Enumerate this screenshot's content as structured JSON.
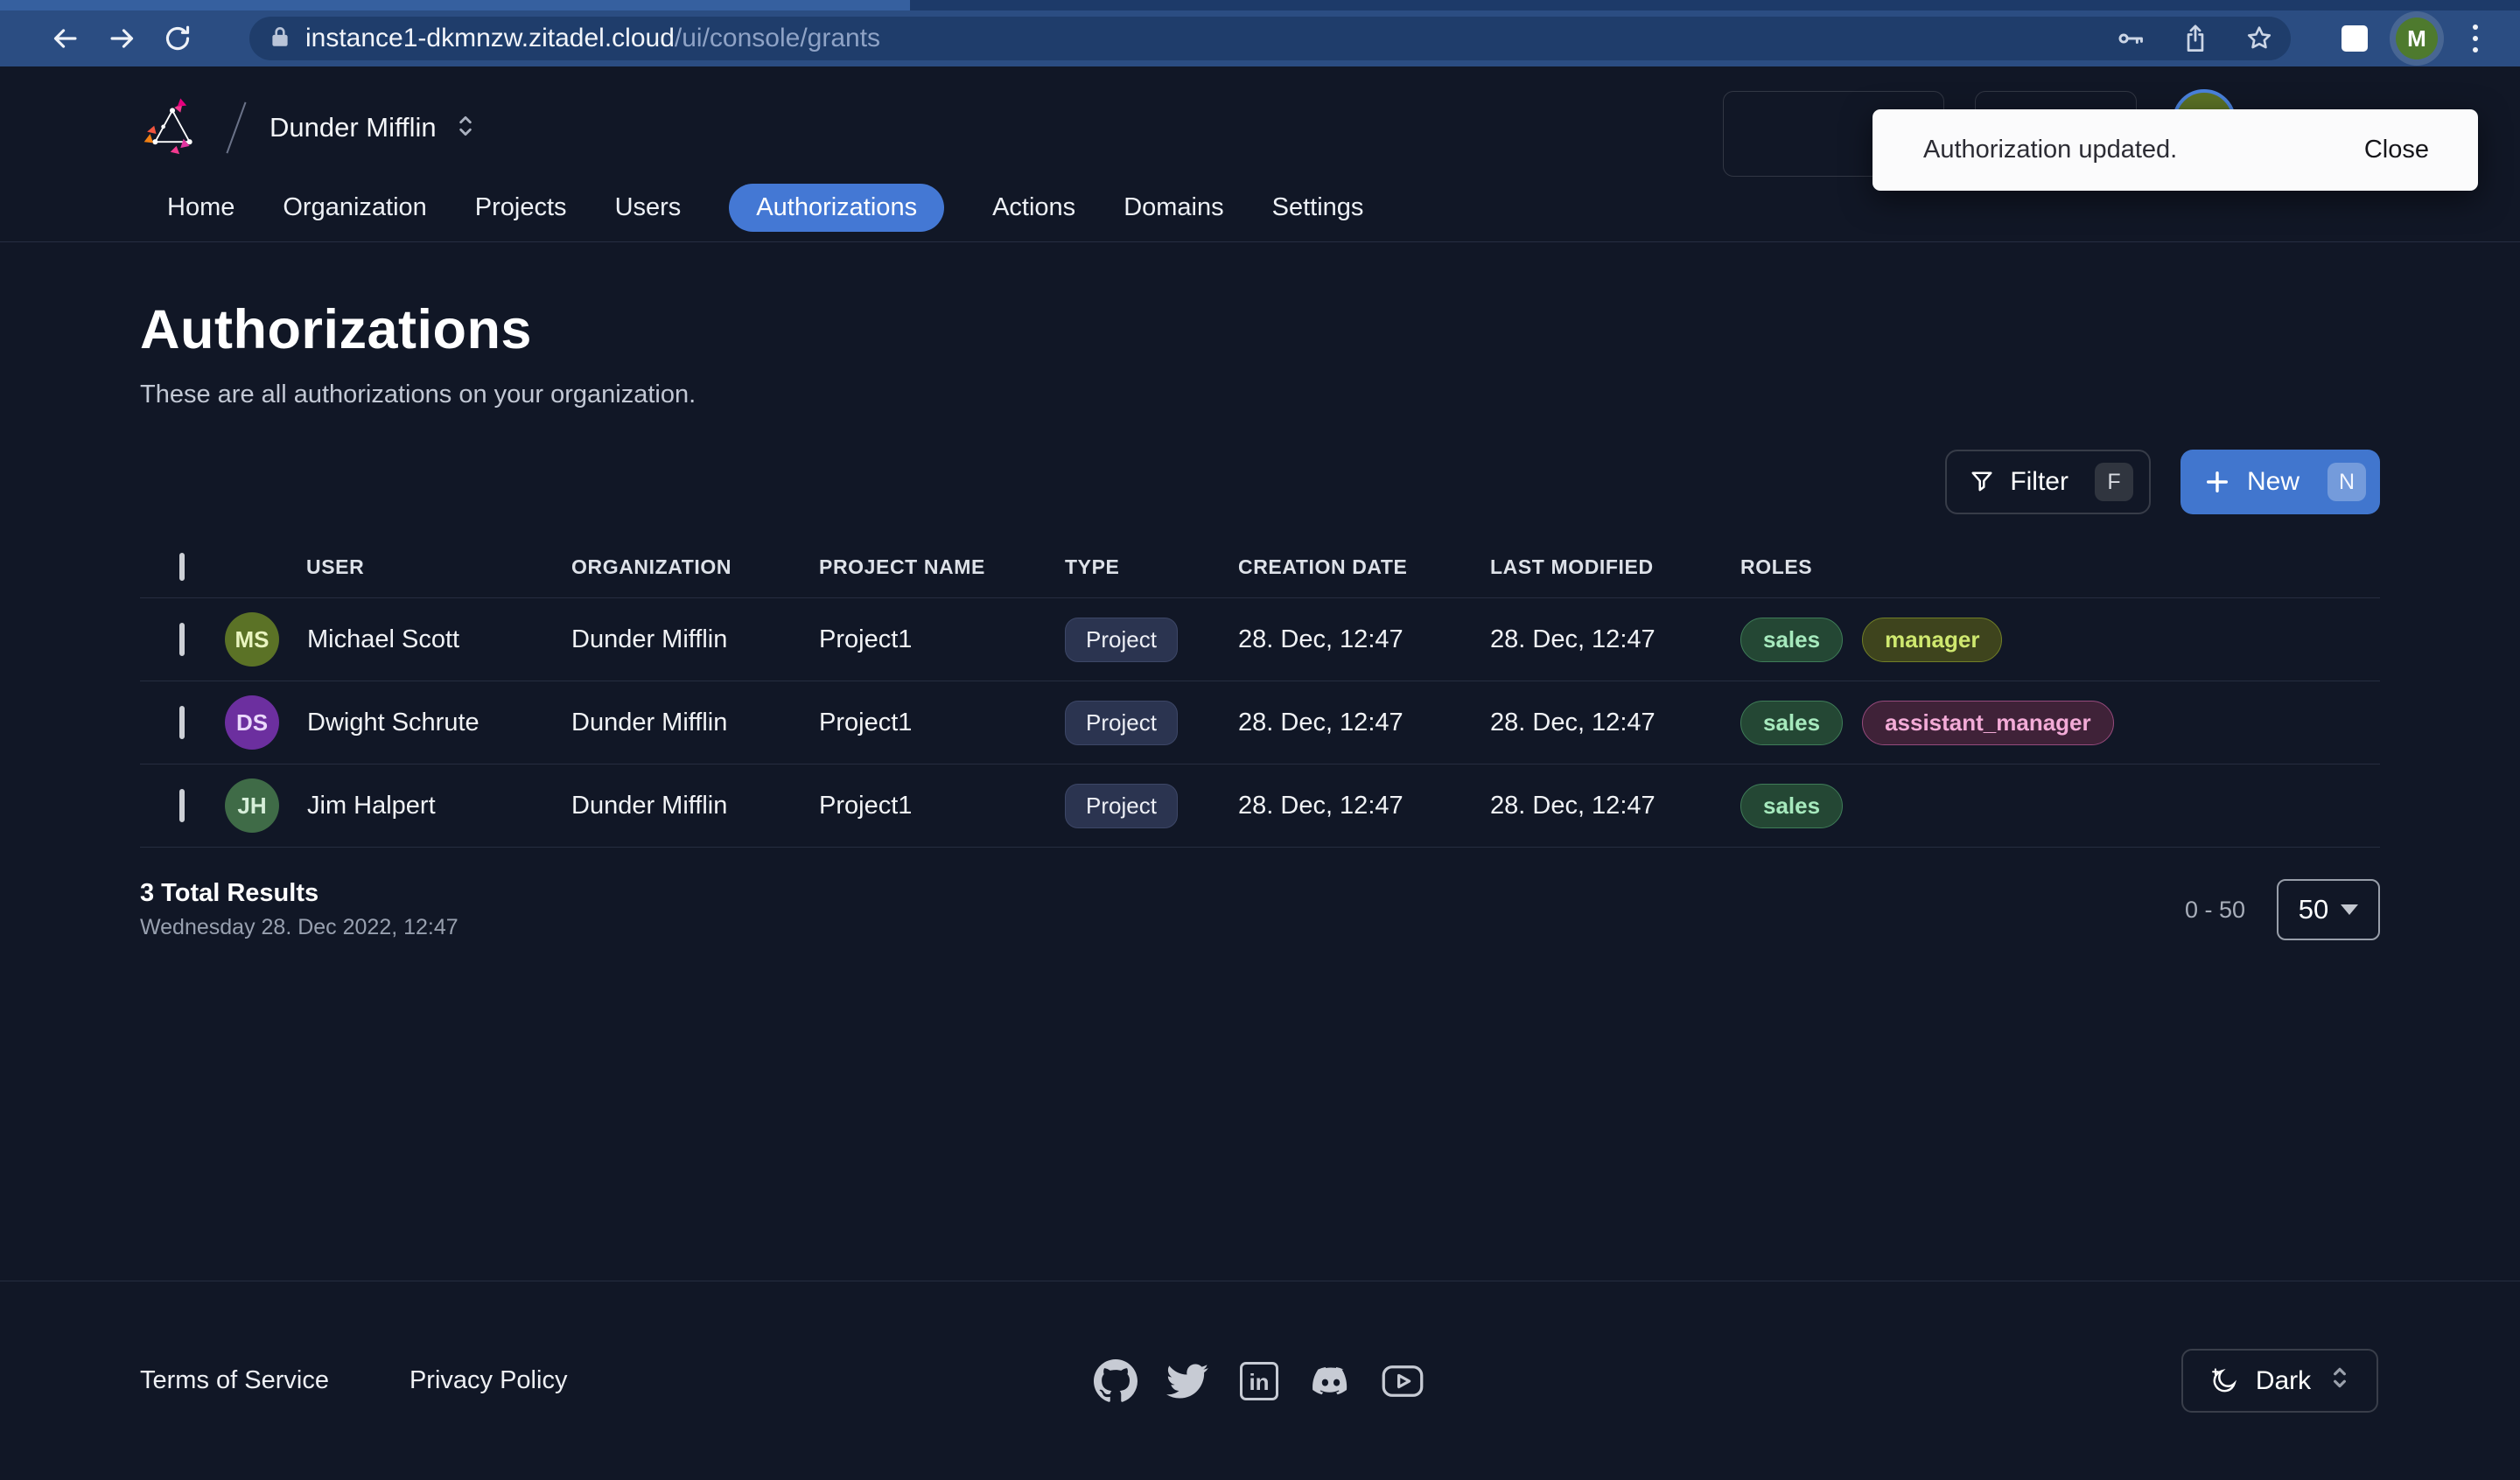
{
  "browser": {
    "url_domain": "instance1-dkmnzw.zitadel.cloud",
    "url_path": "/ui/console/grants",
    "profile_initial": "M"
  },
  "header": {
    "org_name": "Dunder Mifflin",
    "nav": [
      "Home",
      "Organization",
      "Projects",
      "Users",
      "Authorizations",
      "Actions",
      "Domains",
      "Settings"
    ],
    "active_tab": "Authorizations",
    "help_label": "?"
  },
  "toast": {
    "message": "Authorization updated.",
    "close_label": "Close"
  },
  "page": {
    "title": "Authorizations",
    "subtitle": "These are all authorizations on your organization."
  },
  "actions": {
    "filter_label": "Filter",
    "filter_shortcut": "F",
    "new_label": "New",
    "new_shortcut": "N"
  },
  "table": {
    "columns": [
      "USER",
      "ORGANIZATION",
      "PROJECT NAME",
      "TYPE",
      "CREATION DATE",
      "LAST MODIFIED",
      "ROLES"
    ],
    "rows": [
      {
        "initials": "MS",
        "avatar_style": "background:#5b7226;color:#e9f4bf",
        "user": "Michael Scott",
        "organization": "Dunder Mifflin",
        "project": "Project1",
        "type": "Project",
        "creation_date": "28. Dec, 12:47",
        "last_modified": "28. Dec, 12:47",
        "roles": [
          {
            "label": "sales",
            "style": "background:#244734;border-color:#3f7c58;color:#a6e9bd"
          },
          {
            "label": "manager",
            "style": "background:#3e441d;border-color:#717f27;color:#cfe86f"
          }
        ]
      },
      {
        "initials": "DS",
        "avatar_style": "background:#6c2f9f;color:#ead9fb",
        "user": "Dwight Schrute",
        "organization": "Dunder Mifflin",
        "project": "Project1",
        "type": "Project",
        "creation_date": "28. Dec, 12:47",
        "last_modified": "28. Dec, 12:47",
        "roles": [
          {
            "label": "sales",
            "style": "background:#244734;border-color:#3f7c58;color:#a6e9bd"
          },
          {
            "label": "assistant_manager",
            "style": "background:#3f2238;border-color:#964a7c;color:#f3abd7"
          }
        ]
      },
      {
        "initials": "JH",
        "avatar_style": "background:#3f6b47;color:#d6eed9",
        "user": "Jim Halpert",
        "organization": "Dunder Mifflin",
        "project": "Project1",
        "type": "Project",
        "creation_date": "28. Dec, 12:47",
        "last_modified": "28. Dec, 12:47",
        "roles": [
          {
            "label": "sales",
            "style": "background:#244734;border-color:#3f7c58;color:#a6e9bd"
          }
        ]
      }
    ],
    "summary": {
      "total": "3 Total Results",
      "timestamp": "Wednesday 28. Dec 2022, 12:47"
    },
    "pagination": {
      "range": "0 - 50",
      "page_size": "50"
    }
  },
  "footer": {
    "terms": "Terms of Service",
    "privacy": "Privacy Policy",
    "social": [
      "github",
      "twitter",
      "linkedin",
      "discord",
      "youtube"
    ],
    "linkedin_glyph": "in",
    "theme": "Dark"
  },
  "colors": {
    "accent": "#4478d4",
    "chrome_blue": "#2b4d82",
    "background": "#111726",
    "toast_bg": "#fbfbfc"
  }
}
